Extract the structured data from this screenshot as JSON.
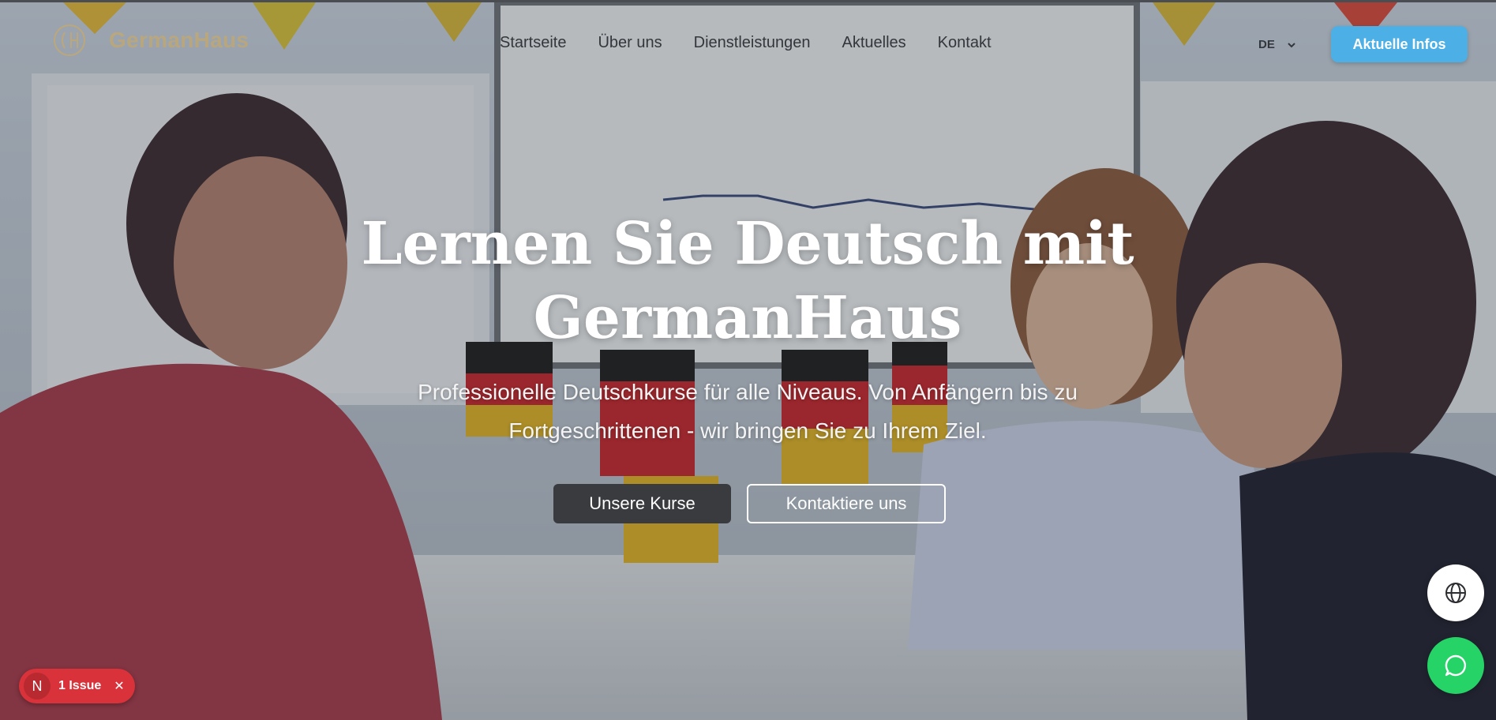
{
  "brand": {
    "name": "GermanHaus",
    "logo_letters": "GH"
  },
  "nav": {
    "items": [
      {
        "label": "Startseite"
      },
      {
        "label": "Über uns"
      },
      {
        "label": "Dienstleistungen"
      },
      {
        "label": "Aktuelles"
      },
      {
        "label": "Kontakt"
      }
    ],
    "language": "DE",
    "cta_label": "Aktuelle Infos"
  },
  "hero": {
    "headline_line1": "Lernen Sie Deutsch mit",
    "headline_line2": "GermanHaus",
    "subline_line1": "Professionelle Deutschkurse für alle Niveaus. Von Anfängern bis zu",
    "subline_line2": "Fortgeschrittenen - wir bringen Sie zu Ihrem Ziel.",
    "primary_button": "Unsere Kurse",
    "secondary_button": "Kontaktiere uns"
  },
  "floating": {
    "globe_icon": "globe-icon",
    "chat_icon": "whatsapp-chat-icon"
  },
  "issue_badge": {
    "letter": "N",
    "text": "1 Issue"
  },
  "colors": {
    "accent": "#4cb0e6",
    "primary_button": "#3a3b3f",
    "chat": "#25d366",
    "issue": "#d9323a",
    "logo": "#d2aa5a"
  }
}
